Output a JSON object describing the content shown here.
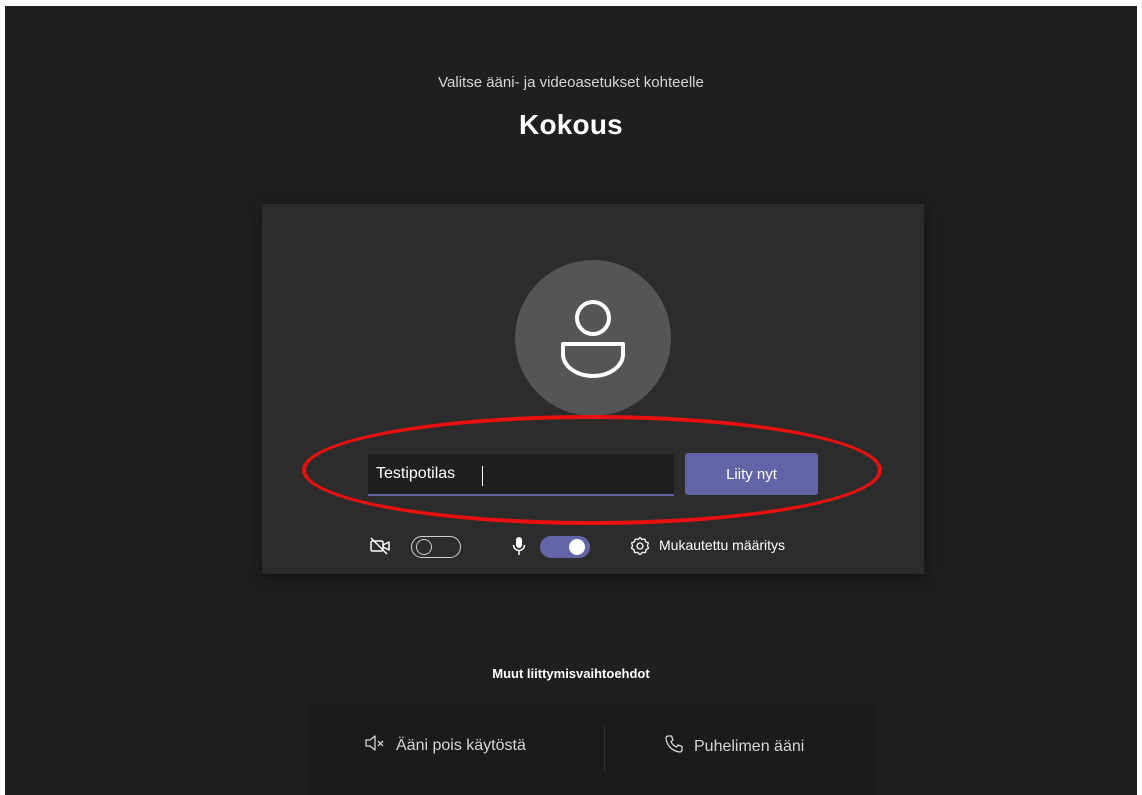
{
  "prejoin": {
    "subtitle": "Valitse ääni- ja videoasetukset kohteelle",
    "meeting_title": "Kokous"
  },
  "card": {
    "name_value": "Testipotilas",
    "join_label": "Liity nyt",
    "camera_on": false,
    "mic_on": true,
    "settings_label": "Mukautettu määritys"
  },
  "other_options": {
    "heading": "Muut liittymisvaihtoehdot",
    "audio_off_label": "Ääni pois käytöstä",
    "phone_audio_label": "Puhelimen ääni"
  },
  "colors": {
    "accent": "#6264a7",
    "background": "#1f1f1f",
    "card": "#2d2c2c",
    "annotation": "#e8110f"
  }
}
